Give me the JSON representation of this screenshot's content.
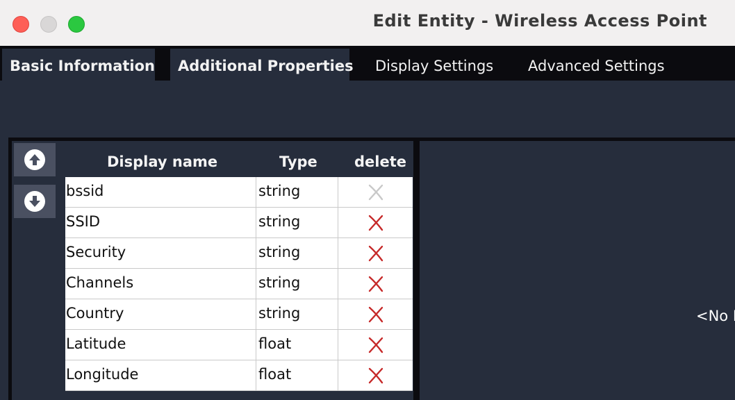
{
  "window": {
    "title": "Edit Entity - Wireless Access Point"
  },
  "tabs": [
    {
      "label": "Basic Information",
      "active": false
    },
    {
      "label": "Additional Properties",
      "active": true
    },
    {
      "label": "Display Settings",
      "active": false
    },
    {
      "label": "Advanced Settings",
      "active": false
    }
  ],
  "toolbar": {
    "move_up_icon": "arrow-up-circle-icon",
    "move_down_icon": "arrow-down-circle-icon"
  },
  "table": {
    "headers": {
      "name": "Display name",
      "type": "Type",
      "delete": "delete"
    },
    "rows": [
      {
        "name": "bssid",
        "type": "string",
        "deletable": false
      },
      {
        "name": "SSID",
        "type": "string",
        "deletable": true
      },
      {
        "name": "Security",
        "type": "string",
        "deletable": true
      },
      {
        "name": "Channels",
        "type": "string",
        "deletable": true
      },
      {
        "name": "Country",
        "type": "string",
        "deletable": true
      },
      {
        "name": "Latitude",
        "type": "float",
        "deletable": true
      },
      {
        "name": "Longitude",
        "type": "float",
        "deletable": true
      }
    ]
  },
  "detail": {
    "empty_text": "<No Property Selected>"
  },
  "colors": {
    "delete_enabled": "#c62828",
    "delete_disabled": "#c8c8c8",
    "tab_active_bg": "#262d3c",
    "tabbar_bg": "#0b0b0f"
  }
}
